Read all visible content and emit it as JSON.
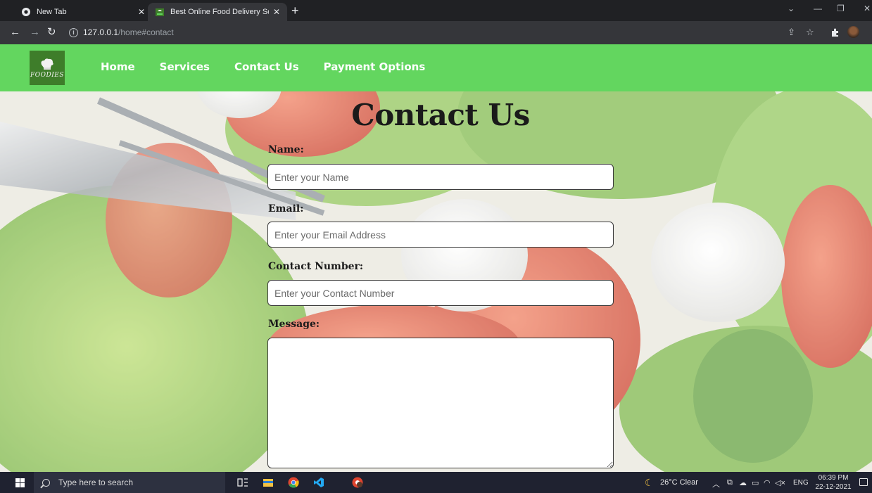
{
  "browser": {
    "tabs": [
      {
        "label": "New Tab"
      },
      {
        "label": "Best Online Food Delivery Servic"
      }
    ],
    "url_host": "127.0.0.1",
    "url_path": "/home#contact"
  },
  "site": {
    "logo_text": "FOODIES",
    "nav": [
      "Home",
      "Services",
      "Contact Us",
      "Payment Options"
    ]
  },
  "contact": {
    "title": "Contact Us",
    "fields": [
      {
        "label": "Name:",
        "placeholder": "Enter your Name",
        "value": ""
      },
      {
        "label": "Email:",
        "placeholder": "Enter your Email Address",
        "value": ""
      },
      {
        "label": "Contact Number:",
        "placeholder": "Enter your Contact Number",
        "value": ""
      }
    ],
    "message_label": "Message:",
    "message_value": ""
  },
  "taskbar": {
    "search_placeholder": "Type here to search",
    "weather": "26°C  Clear",
    "language": "ENG",
    "time": "06:39 PM",
    "date": "22-12-2021"
  },
  "colors": {
    "nav_green": "#63d65f",
    "logo_green": "#3e7d2a",
    "browser_dark": "#202124",
    "browser_toolbar": "#35363a",
    "taskbar": "#1f2230"
  },
  "icons": [
    "chrome-icon",
    "foodies-favicon",
    "back-arrow-icon",
    "forward-arrow-icon",
    "reload-icon",
    "info-icon",
    "share-icon",
    "star-icon",
    "extensions-icon",
    "profile-avatar",
    "windows-start-icon",
    "search-icon",
    "task-view-icon",
    "file-explorer-icon",
    "chrome-taskbar-icon",
    "vscode-icon",
    "weather-moon-icon"
  ]
}
